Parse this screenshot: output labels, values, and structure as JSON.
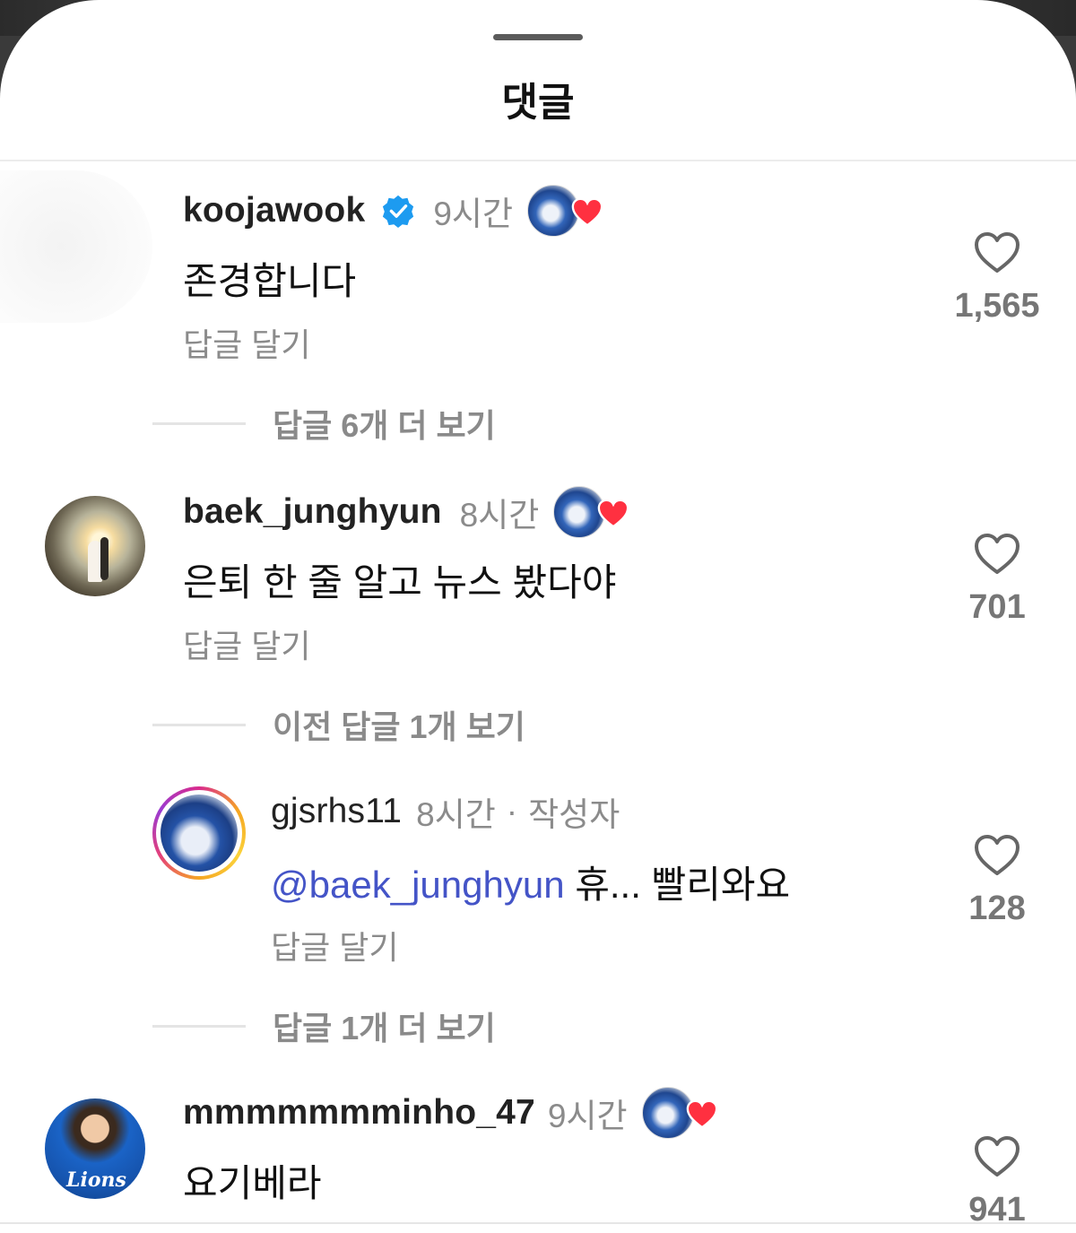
{
  "sheet": {
    "title": "댓글"
  },
  "comments": [
    {
      "username": "koojawook",
      "verified": true,
      "time": "9시간",
      "text": "존경합니다",
      "reply_label": "답글 달기",
      "likes": "1,565",
      "more_replies": "답글 6개 더 보기"
    },
    {
      "username": "baek_junghyun",
      "verified": false,
      "time": "8시간",
      "text": "은퇴 한 줄 알고 뉴스 봤다야",
      "reply_label": "답글 달기",
      "likes": "701",
      "more_replies": "이전 답글 1개 보기"
    },
    {
      "username": "gjsrhs11",
      "verified": false,
      "time": "8시간",
      "author_label": "작성자",
      "mention": "@baek_junghyun",
      "text": "휴... 빨리와요",
      "reply_label": "답글 달기",
      "likes": "128",
      "more_replies": "답글 1개 더 보기"
    },
    {
      "username": "mmmmmmminho_47",
      "verified": false,
      "time": "9시간",
      "text": "요기베라",
      "likes": "941"
    }
  ],
  "avatars": {
    "player_jersey_text": "Lions"
  },
  "icons": {
    "verified": "verified-badge-icon",
    "creator_liked": "heart-icon",
    "like": "heart-outline-icon"
  },
  "colors": {
    "verified": "#1D9BF0",
    "heart": "#FF3040",
    "mention": "#4454C7",
    "secondary_text": "#8B8B8B"
  }
}
